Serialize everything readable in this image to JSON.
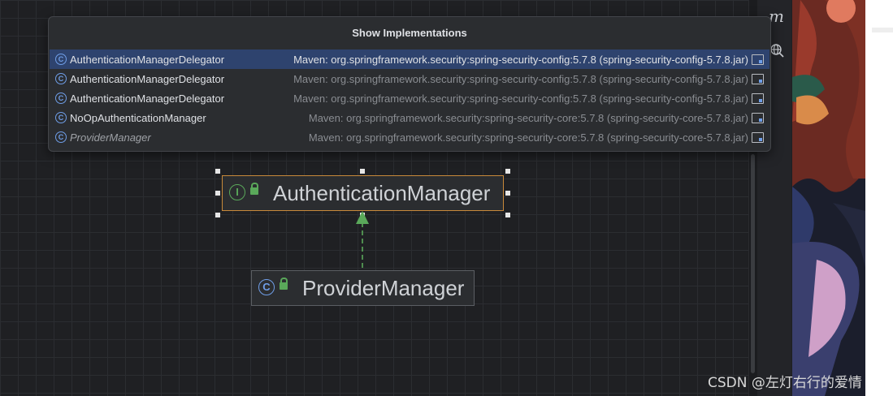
{
  "popup": {
    "title": "Show Implementations",
    "rows": [
      {
        "name": "AuthenticationManagerDelegator",
        "location": "Maven: org.springframework.security:spring-security-config:5.7.8 (spring-security-config-5.7.8.jar)",
        "selected": true,
        "icon": "class-icon"
      },
      {
        "name": "AuthenticationManagerDelegator",
        "location": "Maven: org.springframework.security:spring-security-config:5.7.8 (spring-security-config-5.7.8.jar)",
        "icon": "class-icon"
      },
      {
        "name": "AuthenticationManagerDelegator",
        "location": "Maven: org.springframework.security:spring-security-config:5.7.8 (spring-security-config-5.7.8.jar)",
        "icon": "class-icon"
      },
      {
        "name": "NoOpAuthenticationManager",
        "location": "Maven: org.springframework.security:spring-security-core:5.7.8 (spring-security-core-5.7.8.jar)",
        "icon": "class-icon"
      },
      {
        "name": "ProviderManager",
        "location": "Maven: org.springframework.security:spring-security-core:5.7.8 (spring-security-core-5.7.8.jar)",
        "icon": "class-icon"
      }
    ]
  },
  "diagram": {
    "interface_node": {
      "label": "AuthenticationManager",
      "icon_letter": "I",
      "icon": "interface-icon"
    },
    "class_node": {
      "label": "ProviderManager",
      "icon_letter": "C",
      "icon": "class-icon"
    }
  },
  "toolbar": {
    "m_glyph": "m"
  },
  "watermark": "CSDN @左灯右行的爱情",
  "colors": {
    "selection": "#2e436e",
    "interface": "#5aa85a",
    "class": "#6f9ee8",
    "selected_border": "#c8893a"
  }
}
